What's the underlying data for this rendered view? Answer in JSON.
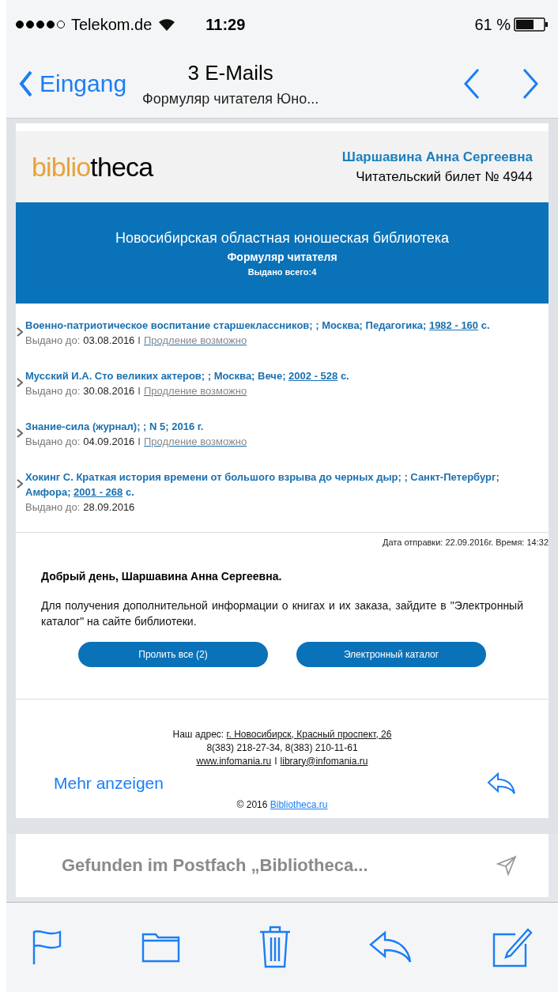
{
  "status_bar": {
    "carrier": "Telekom.de",
    "time": "11:29",
    "battery": "61 %"
  },
  "nav": {
    "back": "Eingang",
    "title": "3 E-Mails",
    "subtitle": "Формуляр читателя Юно..."
  },
  "email": {
    "logo": {
      "part1": "biblio",
      "part2": "theca"
    },
    "reader_name": "Шаршавина Анна Сергеевна",
    "card": "Читательский билет № 4944",
    "banner": {
      "library": "Новосибирская областная юношеская библиотека",
      "form": "Формуляр читателя",
      "issued": "Выдано всего:4"
    },
    "books": [
      {
        "title": "Военно-патриотическое воспитание старшеклассников; ; Москва; Педагогика;",
        "link": "1982 - 160",
        "suffix": "с.",
        "due_label": "Выдано до:",
        "due": "03.08.2016",
        "separator": "I",
        "renewal": "Продление возможно"
      },
      {
        "title": "Мусский И.А. Сто великих актеров; ; Москва; Вече;",
        "link": "2002 - 528",
        "suffix": "с.",
        "due_label": "Выдано до:",
        "due": "30.08.2016",
        "separator": "I",
        "renewal": "Продление возможно"
      },
      {
        "title": "Знание-сила (журнал); ; N 5; 2016 г.",
        "due_label": "Выдано до:",
        "due": "04.09.2016",
        "separator": "I",
        "renewal": "Продление возможно"
      },
      {
        "title": "Хокинг С. Краткая история времени от большого взрыва до черных дыр; ; Санкт-Петербург; Амфора;",
        "link": "2001 - 268",
        "suffix": "с.",
        "due_label": "Выдано до:",
        "due": "28.09.2016"
      }
    ],
    "sent": "Дата отправки: 22.09.2016г. Время: 14:32",
    "greeting": "Добрый день, Шаршавина Анна Сергеевна.",
    "info": "Для получения дополнительной информации о книгах и их заказа, зайдите в \"Электронный каталог\" на сайте библиотеки.",
    "buttons": [
      "Пролить все (2)",
      "Электронный каталог"
    ],
    "footer": {
      "address_label": "Наш адрес:",
      "address": "г. Новосибирск, Красный проспект, 26",
      "phones": "8(383) 218-27-34, 8(383) 210-11-61",
      "site": "www.infomania.ru",
      "separator": "I",
      "mail": "library@infomania.ru",
      "copyright": "© 2016",
      "copyright_link": "Bibliotheca.ru"
    },
    "more": "Mehr anzeigen"
  },
  "search_hint": "Gefunden im Postfach „Bibliotheca..."
}
